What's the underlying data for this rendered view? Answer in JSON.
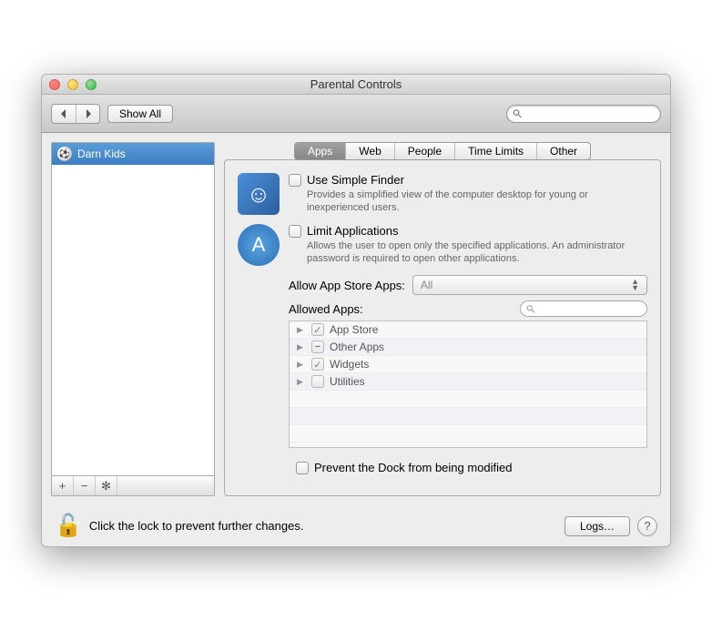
{
  "window": {
    "title": "Parental Controls"
  },
  "toolbar": {
    "show_all": "Show All",
    "search_placeholder": ""
  },
  "sidebar": {
    "users": [
      {
        "name": "Darn Kids",
        "selected": true
      }
    ]
  },
  "tabs": [
    "Apps",
    "Web",
    "People",
    "Time Limits",
    "Other"
  ],
  "tab_active": 0,
  "pane": {
    "simple_finder": {
      "title": "Use Simple Finder",
      "desc": "Provides a simplified view of the computer desktop for young or inexperienced users.",
      "checked": false
    },
    "limit_apps": {
      "title": "Limit Applications",
      "desc": "Allows the user to open only the specified applications. An administrator password is required to open other applications.",
      "checked": false
    },
    "allow_store_label": "Allow App Store Apps:",
    "allow_store_value": "All",
    "allowed_label": "Allowed Apps:",
    "tree": [
      {
        "label": "App Store",
        "state": "checked"
      },
      {
        "label": "Other Apps",
        "state": "mixed"
      },
      {
        "label": "Widgets",
        "state": "checked"
      },
      {
        "label": "Utilities",
        "state": "unchecked"
      }
    ],
    "prevent_dock": {
      "label": "Prevent the Dock from being modified",
      "checked": false
    }
  },
  "footer": {
    "lock_text": "Click the lock to prevent further changes.",
    "logs_label": "Logs…"
  }
}
